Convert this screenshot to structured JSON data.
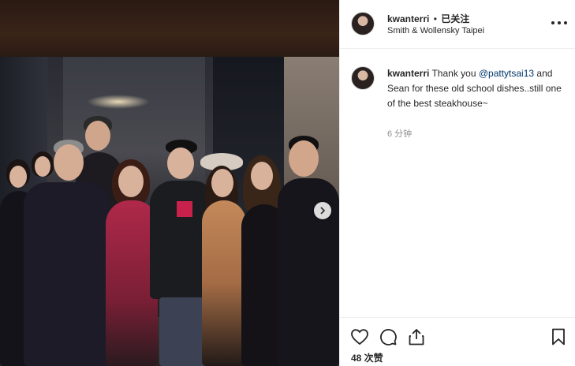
{
  "post": {
    "username": "kwanterri",
    "separator": "•",
    "follow_status": "已关注",
    "location": "Smith & Wollensky Taipei"
  },
  "comment": {
    "username": "kwanterri",
    "text_before": " Thank you ",
    "mention": "@pattytsai13",
    "text_after": " and Sean for these old school dishes..still one of the best steakhouse~",
    "time": "6 分钟"
  },
  "footer": {
    "likes_label": "48 次赞"
  },
  "icons": {
    "more": "more-options-icon",
    "next": "chevron-right-icon",
    "like": "heart-icon",
    "comment": "comment-bubble-icon",
    "share": "share-icon",
    "save": "bookmark-icon"
  },
  "colors": {
    "mention": "#00376b",
    "secondary_text": "#8e8e8e",
    "text": "#262626",
    "divider": "#efefef"
  }
}
